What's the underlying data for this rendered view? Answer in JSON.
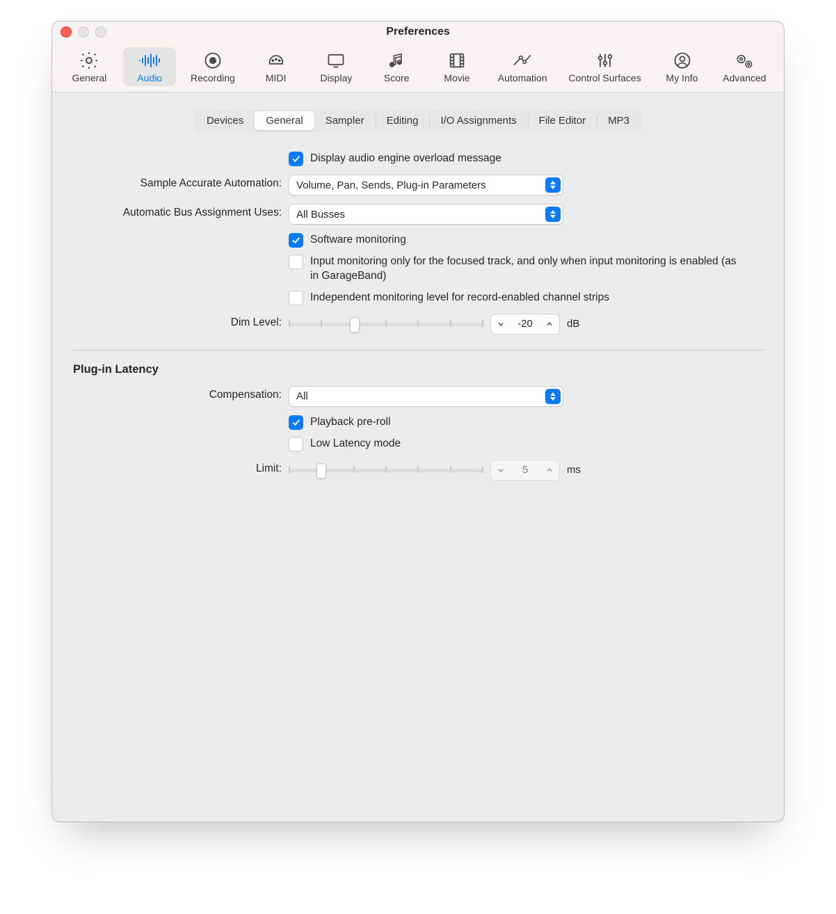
{
  "window": {
    "title": "Preferences"
  },
  "toolbar": {
    "items": [
      {
        "id": "general",
        "label": "General"
      },
      {
        "id": "audio",
        "label": "Audio"
      },
      {
        "id": "recording",
        "label": "Recording"
      },
      {
        "id": "midi",
        "label": "MIDI"
      },
      {
        "id": "display",
        "label": "Display"
      },
      {
        "id": "score",
        "label": "Score"
      },
      {
        "id": "movie",
        "label": "Movie"
      },
      {
        "id": "automation",
        "label": "Automation"
      },
      {
        "id": "control_surfaces",
        "label": "Control Surfaces"
      },
      {
        "id": "my_info",
        "label": "My Info"
      },
      {
        "id": "advanced",
        "label": "Advanced"
      }
    ],
    "active": "audio"
  },
  "subtabs": {
    "items": [
      {
        "id": "devices",
        "label": "Devices"
      },
      {
        "id": "general",
        "label": "General"
      },
      {
        "id": "sampler",
        "label": "Sampler"
      },
      {
        "id": "editing",
        "label": "Editing"
      },
      {
        "id": "io",
        "label": "I/O Assignments"
      },
      {
        "id": "file_editor",
        "label": "File Editor"
      },
      {
        "id": "mp3",
        "label": "MP3"
      }
    ],
    "active": "general"
  },
  "general": {
    "display_overload": {
      "label": "Display audio engine overload message",
      "checked": true
    },
    "sample_accurate_label": "Sample Accurate Automation:",
    "sample_accurate_value": "Volume, Pan, Sends, Plug-in Parameters",
    "auto_bus_label": "Automatic Bus Assignment Uses:",
    "auto_bus_value": "All Busses",
    "software_monitoring": {
      "label": "Software monitoring",
      "checked": true
    },
    "input_monitoring_focused": {
      "label": "Input monitoring only for the focused track, and only when input monitoring is enabled (as in GarageBand)",
      "checked": false
    },
    "independent_monitoring": {
      "label": "Independent monitoring level for record-enabled channel strips",
      "checked": false
    },
    "dim_level_label": "Dim Level:",
    "dim_level_value": "-20",
    "dim_level_unit": "dB"
  },
  "latency": {
    "section_title": "Plug-in Latency",
    "compensation_label": "Compensation:",
    "compensation_value": "All",
    "playback_preroll": {
      "label": "Playback pre-roll",
      "checked": true
    },
    "low_latency": {
      "label": "Low Latency mode",
      "checked": false
    },
    "limit_label": "Limit:",
    "limit_value": "5",
    "limit_unit": "ms"
  }
}
